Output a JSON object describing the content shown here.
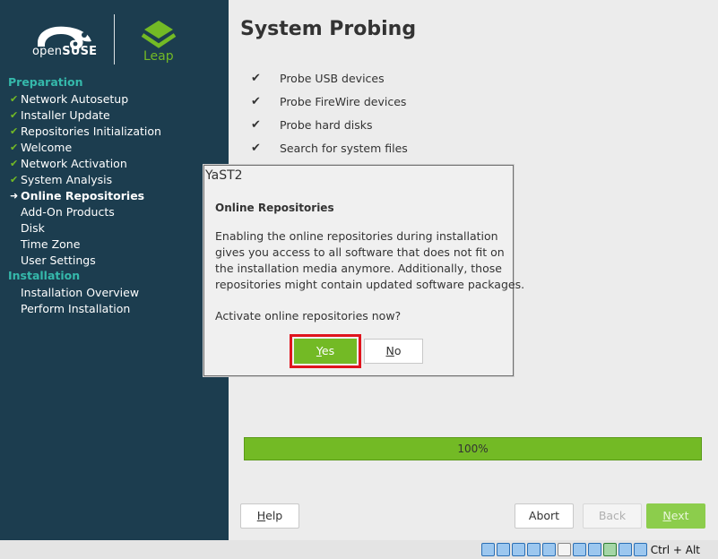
{
  "sidebar": {
    "brand_open": "open",
    "brand_suse": "SUSE",
    "brand_leap": "Leap",
    "colors": {
      "background": "#1c3d4f",
      "heading": "#35b9ab",
      "check": "#73ba25"
    },
    "sections": [
      {
        "heading": "Preparation",
        "steps": [
          {
            "label": "Network Autosetup",
            "state": "done"
          },
          {
            "label": "Installer Update",
            "state": "done"
          },
          {
            "label": "Repositories Initialization",
            "state": "done"
          },
          {
            "label": "Welcome",
            "state": "done"
          },
          {
            "label": "Network Activation",
            "state": "done"
          },
          {
            "label": "System Analysis",
            "state": "done"
          },
          {
            "label": "Online Repositories",
            "state": "current"
          },
          {
            "label": "Add-On Products",
            "state": "todo"
          },
          {
            "label": "Disk",
            "state": "todo"
          },
          {
            "label": "Time Zone",
            "state": "todo"
          },
          {
            "label": "User Settings",
            "state": "todo"
          }
        ]
      },
      {
        "heading": "Installation",
        "steps": [
          {
            "label": "Installation Overview",
            "state": "todo"
          },
          {
            "label": "Perform Installation",
            "state": "todo"
          }
        ]
      }
    ],
    "marks": {
      "done": "✔",
      "current": "➜",
      "todo": ""
    }
  },
  "main": {
    "title": "System Probing",
    "probe_items": [
      {
        "check": "✔",
        "label": "Probe USB devices"
      },
      {
        "check": "✔",
        "label": "Probe FireWire devices"
      },
      {
        "check": "✔",
        "label": "Probe hard disks"
      },
      {
        "check": "✔",
        "label": "Search for system files"
      }
    ],
    "progress": {
      "label": "100%",
      "percent": 100
    },
    "buttons": {
      "help": {
        "mnemonic": "H",
        "rest": "elp"
      },
      "abort": "Abort",
      "back": "Back",
      "next": {
        "mnemonic": "N",
        "rest": "ext"
      }
    }
  },
  "dialog": {
    "title": "YaST2",
    "heading": "Online Repositories",
    "body_lines": [
      "Enabling the online repositories during installation",
      "gives you access to all software that does not fit on",
      "the installation media anymore. Additionally, those",
      "repositories might contain updated software packages."
    ],
    "question": "Activate online repositories now?",
    "yes": {
      "mnemonic": "Y",
      "rest": "es"
    },
    "no": {
      "mnemonic": "N",
      "rest": "o"
    }
  },
  "taskbar": {
    "host_key_label": "Ctrl + Alt",
    "tray_icons": [
      "hard-disk-icon",
      "optical-drive-icon",
      "audio-icon",
      "network-icon",
      "usb-icon",
      "shared-folder-icon",
      "display-icon",
      "capture-icon",
      "virtualization-icon",
      "mouse-integration-icon",
      "download-icon"
    ]
  }
}
